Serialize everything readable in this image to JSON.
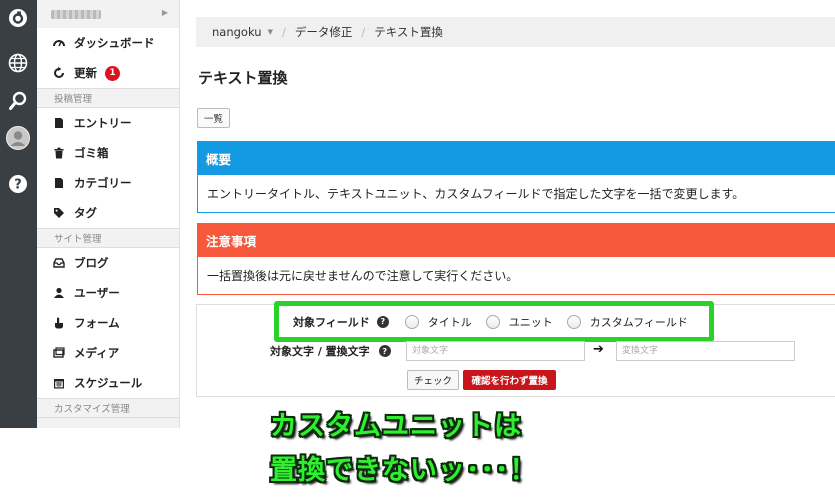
{
  "breadcrumb": {
    "user": "nangoku",
    "section": "データ修正",
    "current": "テキスト置換"
  },
  "sidebar": {
    "items": [
      {
        "label": "ダッシュボード"
      },
      {
        "label": "更新",
        "badge": "1"
      },
      {
        "section": "投稿管理"
      },
      {
        "label": "エントリー"
      },
      {
        "label": "ゴミ箱"
      },
      {
        "label": "カテゴリー"
      },
      {
        "label": "タグ"
      },
      {
        "section": "サイト管理"
      },
      {
        "label": "ブログ"
      },
      {
        "label": "ユーザー"
      },
      {
        "label": "フォーム"
      },
      {
        "label": "メディア"
      },
      {
        "label": "スケジュール"
      },
      {
        "section": "カスタマイズ管理"
      }
    ]
  },
  "page": {
    "title": "テキスト置換",
    "list_button": "一覧",
    "overview": {
      "title": "概要",
      "body": "エントリータイトル、テキストユニット、カスタムフィールドで指定した文字を一括で変更します。"
    },
    "warning": {
      "title": "注意事項",
      "body": "一括置換後は元に戻せませんので注意して実行ください。"
    },
    "form": {
      "field_label": "対象フィールド",
      "options": [
        "タイトル",
        "ユニット",
        "カスタムフィールド"
      ],
      "text_label": "対象文字 / 置換文字",
      "target_placeholder": "対象文字",
      "replace_placeholder": "変換文字",
      "check_button": "チェック",
      "replace_button": "確認を行わず置換"
    }
  },
  "caption": {
    "line1": "カスタムユニットは",
    "line2": "置換できないッ･･･！"
  },
  "colors": {
    "info": "#139ae3",
    "warning": "#f5583b",
    "danger_button": "#c8151b",
    "highlight": "#2ad12a"
  }
}
